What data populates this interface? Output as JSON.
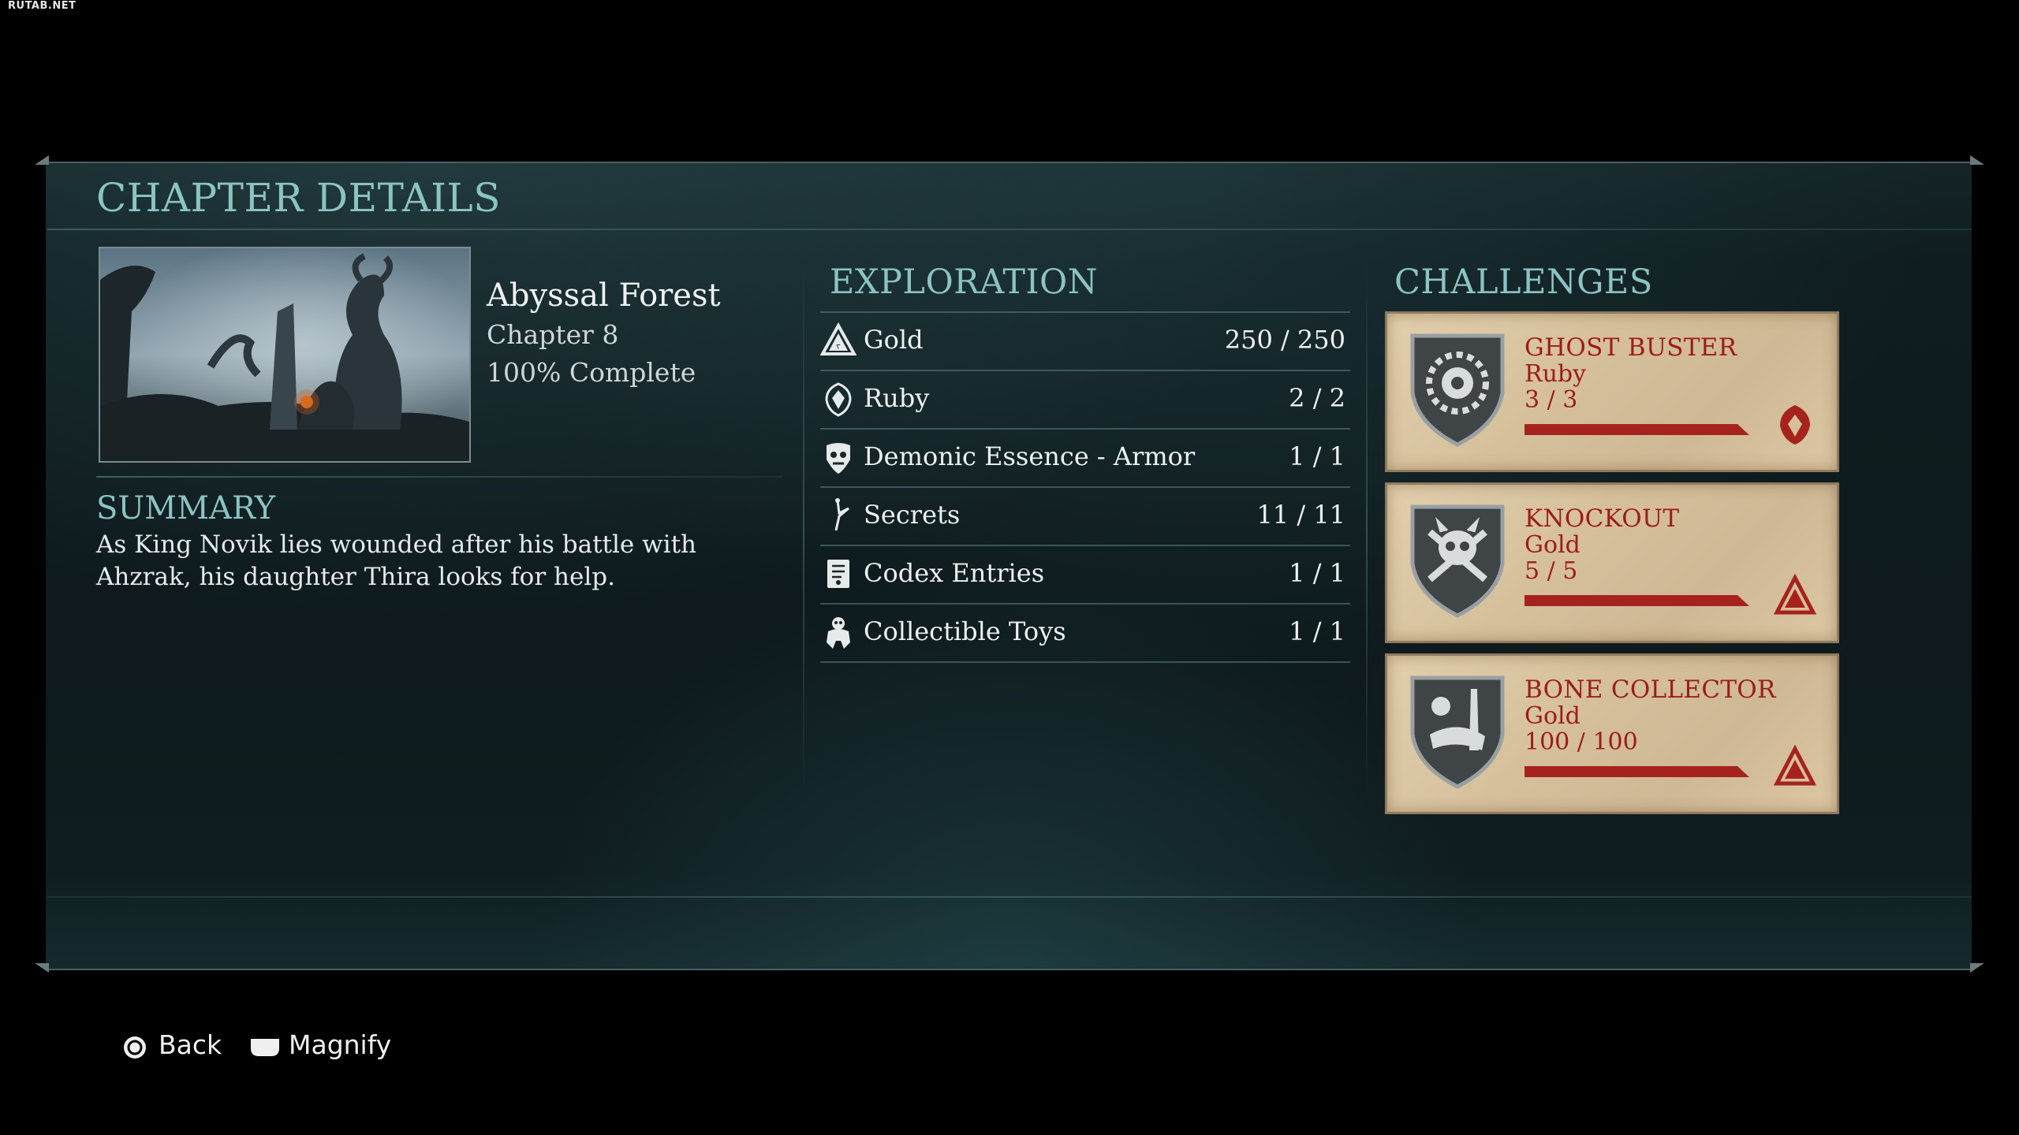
{
  "watermark": "RUTAB.NET",
  "title": "CHAPTER DETAILS",
  "chapter": {
    "name": "Abyssal Forest",
    "number": "Chapter 8",
    "completion": "100% Complete",
    "image_icon": "chapter-thumbnail"
  },
  "summary": {
    "heading": "SUMMARY",
    "text": "As King Novik lies wounded after his battle with Ahzrak, his daughter Thira looks for help."
  },
  "exploration": {
    "heading": "EXPLORATION",
    "items": [
      {
        "icon": "gold-icon",
        "label": "Gold",
        "value": "250 / 250"
      },
      {
        "icon": "ruby-icon",
        "label": "Ruby",
        "value": "2 / 2"
      },
      {
        "icon": "demonic-essence-icon",
        "label": "Demonic Essence - Armor",
        "value": "1 / 1"
      },
      {
        "icon": "secrets-icon",
        "label": "Secrets",
        "value": "11 / 11"
      },
      {
        "icon": "codex-icon",
        "label": "Codex Entries",
        "value": "1 / 1"
      },
      {
        "icon": "toy-icon",
        "label": "Collectible Toys",
        "value": "1 / 1"
      }
    ]
  },
  "challenges": {
    "heading": "CHALLENGES",
    "items": [
      {
        "name": "GHOST BUSTER",
        "reward": "Ruby",
        "progress": "3 / 3",
        "progress_fraction": 1.0,
        "icon": "ghost-buster-shield-icon",
        "reward_icon": "ruby-reward-icon"
      },
      {
        "name": "KNOCKOUT",
        "reward": "Gold",
        "progress": "5 / 5",
        "progress_fraction": 1.0,
        "icon": "knockout-shield-icon",
        "reward_icon": "gold-reward-icon"
      },
      {
        "name": "BONE COLLECTOR",
        "reward": "Gold",
        "progress": "100 / 100",
        "progress_fraction": 1.0,
        "icon": "bone-collector-shield-icon",
        "reward_icon": "gold-reward-icon"
      }
    ]
  },
  "footer": {
    "back_label": "Back",
    "back_icon": "circle-button-icon",
    "magnify_label": "Magnify",
    "magnify_icon": "touchpad-button-icon"
  },
  "colors": {
    "accent_teal": "#8cc3c3",
    "challenge_red": "#9d1c17",
    "parchment": "#d6c09c",
    "panel_bg": "#0f1d20"
  }
}
